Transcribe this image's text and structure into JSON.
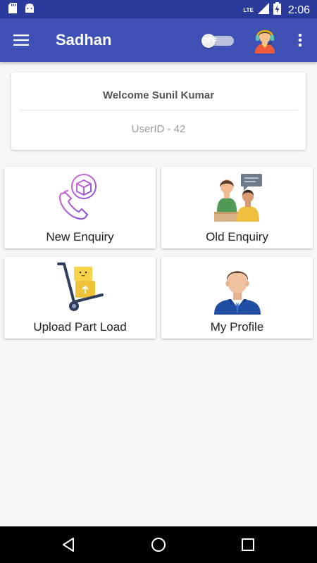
{
  "status_bar": {
    "time": "2:06",
    "network": "LTE",
    "left_icons": [
      "sd-card-icon",
      "android-icon"
    ],
    "right_icons": [
      "signal-icon",
      "battery-charging-icon"
    ]
  },
  "app_bar": {
    "title": "Sadhan",
    "toggle_label": "OFF",
    "toggle_state": "off",
    "background": "#3f51b5"
  },
  "welcome": {
    "greeting": "Welcome Sunil Kumar",
    "user_id": "UserID - 42"
  },
  "tiles": [
    {
      "label": "New Enquiry",
      "icon": "phone-package-icon"
    },
    {
      "label": "Old Enquiry",
      "icon": "customer-service-icon"
    },
    {
      "label": "Upload Part Load",
      "icon": "hand-truck-icon"
    },
    {
      "label": "My Profile",
      "icon": "profile-person-icon"
    }
  ],
  "nav_bar": {
    "buttons": [
      "back-icon",
      "home-icon",
      "recents-icon"
    ]
  }
}
